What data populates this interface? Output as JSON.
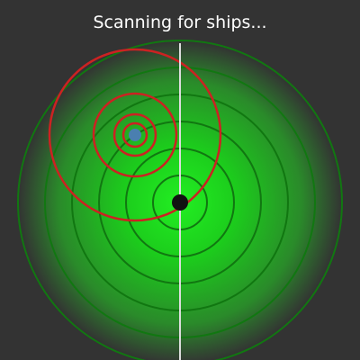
{
  "status": {
    "message": "Scanning for ships..."
  },
  "colors": {
    "background": "#333333",
    "radar_center": "#22ee22",
    "radar_edge": "#333333",
    "radar_rings": "#117711",
    "sweep_line": "#dddddd",
    "radar_origin": "#111111",
    "ship_rings": "#cc2222",
    "ship_marker": "#4a7fb0"
  },
  "radar": {
    "ring_count": 6,
    "origin_visible": true
  },
  "ship": {
    "icon": "ship-blip",
    "ping_ring_count": 4
  }
}
